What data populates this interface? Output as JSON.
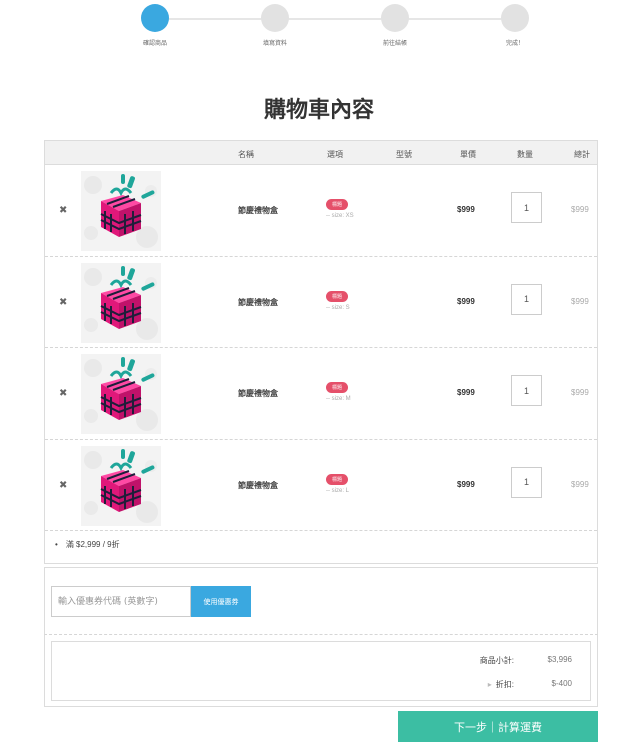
{
  "steps": [
    {
      "label": "確認商品",
      "active": true
    },
    {
      "label": "填寫資料",
      "active": false
    },
    {
      "label": "前往結帳",
      "active": false
    },
    {
      "label": "完成！",
      "active": false
    }
  ],
  "page_title": "購物車內容",
  "table": {
    "headers": {
      "name": "名稱",
      "option": "選項",
      "model": "型號",
      "price": "單價",
      "qty": "數量",
      "total": "總計"
    },
    "rows": [
      {
        "name": "節慶禮物盒",
        "tag": "標題",
        "size": "-- size: XS",
        "price": "$999",
        "qty": "1",
        "total": "$999"
      },
      {
        "name": "節慶禮物盒",
        "tag": "標題",
        "size": "-- size: S",
        "price": "$999",
        "qty": "1",
        "total": "$999"
      },
      {
        "name": "節慶禮物盒",
        "tag": "標題",
        "size": "-- size: M",
        "price": "$999",
        "qty": "1",
        "total": "$999"
      },
      {
        "name": "節慶禮物盒",
        "tag": "標題",
        "size": "-- size: L",
        "price": "$999",
        "qty": "1",
        "total": "$999"
      }
    ],
    "remove_glyph": "✖",
    "promo": "滿 $2,999 / 9折"
  },
  "coupon": {
    "placeholder": "輸入優惠券代碼 (英數字)",
    "button": "使用優惠券"
  },
  "summary": {
    "subtotal_label": "商品小計:",
    "subtotal_value": "$3,996",
    "discount_label": "折扣:",
    "discount_value": "$-400"
  },
  "next_button": "下一步｜計算運費",
  "colors": {
    "accent": "#3aa8e0",
    "next": "#3cbea3",
    "tag": "#e5506a",
    "gift": "#e0187a"
  },
  "icons": {
    "remove": "close-icon",
    "product": "gift-box-image"
  }
}
